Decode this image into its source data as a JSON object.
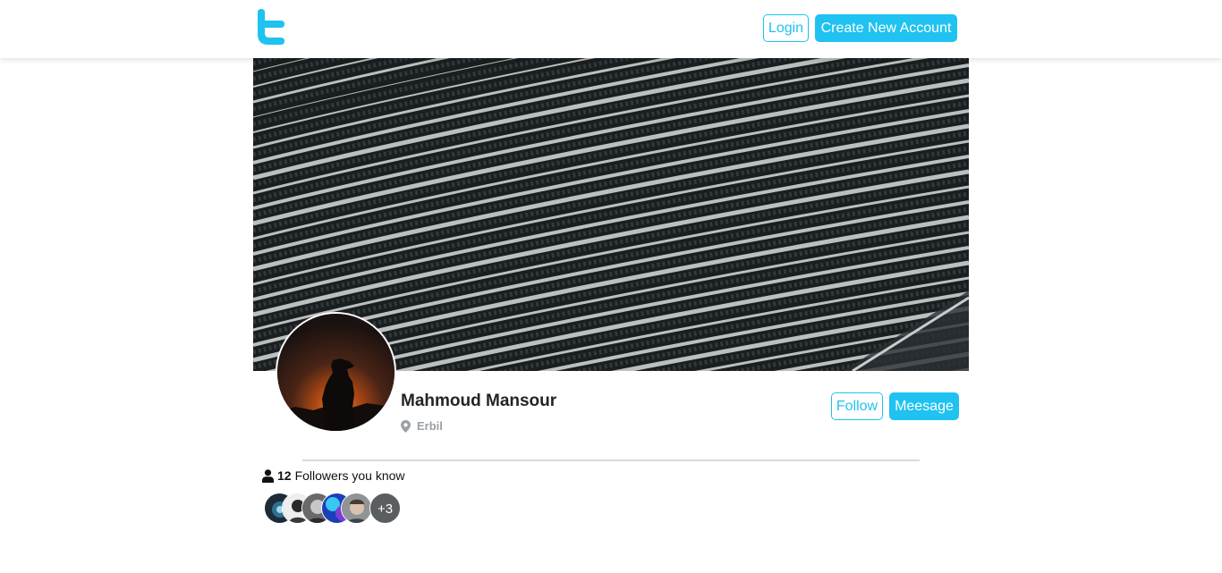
{
  "nav": {
    "logo_icon": "twitter-t-logo-icon",
    "login_label": "Login",
    "create_account_label": "Create New Account"
  },
  "profile": {
    "name": "Mahmoud Mansour",
    "location_icon": "map-pin-icon",
    "location": "Erbil",
    "follow_label": "Follow",
    "message_label": "Meesage"
  },
  "followers": {
    "icon": "user-icon",
    "count": "12",
    "label": "Followers you know",
    "more_label": "+3"
  },
  "colors": {
    "accent": "#1fc2f0",
    "muted": "#9aa0a6",
    "more_badge": "#5b5e61"
  }
}
